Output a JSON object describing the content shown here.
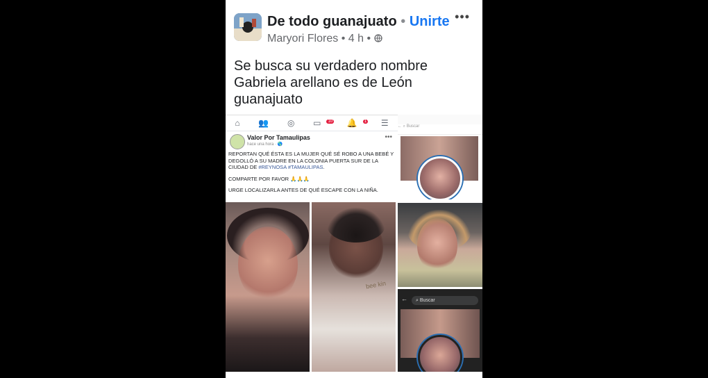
{
  "header": {
    "group_name": "De todo guanajuato",
    "separator": "•",
    "join_label": "Unirte",
    "author": "Maryori Flores",
    "time": "4 h",
    "meta_sep": "•",
    "privacy_icon": "globe-icon",
    "more_label": "•••"
  },
  "post": {
    "lines": [
      "Se busca su verdadero nombre",
      "Gabriela arellano es de León",
      "guanajuato"
    ]
  },
  "embedded": {
    "nav_icons": [
      "home-icon",
      "friends-icon",
      "messenger-icon",
      "video-icon",
      "notifications-icon",
      "menu-icon"
    ],
    "badges": {
      "video": "10",
      "notifications": "1"
    },
    "page_name": "Valor Por Tamaulipas",
    "page_time": "hace una hora · 🌎",
    "more": "•••",
    "para1_a": "REPORTAN QUÉ ÉSTA ES LA MUJER QUÉ SÉ ROBO A UNA BEBÉ Y DEGOLLÓ A SU MADRE EN LA COLONIA PUERTA SUR DE LA CIUDAD DE ",
    "tag1": "#REYNOSA",
    "tag2": "#TAMAULIPAS",
    "para1_end": ".",
    "para2": "COMPARTE POR FAVOR 🙏🙏🙏",
    "para3": "URGE LOCALIZARLA ANTES DE QUÉ ESCAPE CON LA NIÑA."
  },
  "side": {
    "search_placeholder_small": "Buscar",
    "search_placeholder_bottom": "Buscar",
    "back_icon": "arrow-left-icon",
    "baby_shirt_text": "bee kin"
  },
  "colors": {
    "link_blue": "#1877f2",
    "text": "#1c1e21",
    "meta": "#65676b",
    "badge_red": "#e41e3f"
  }
}
